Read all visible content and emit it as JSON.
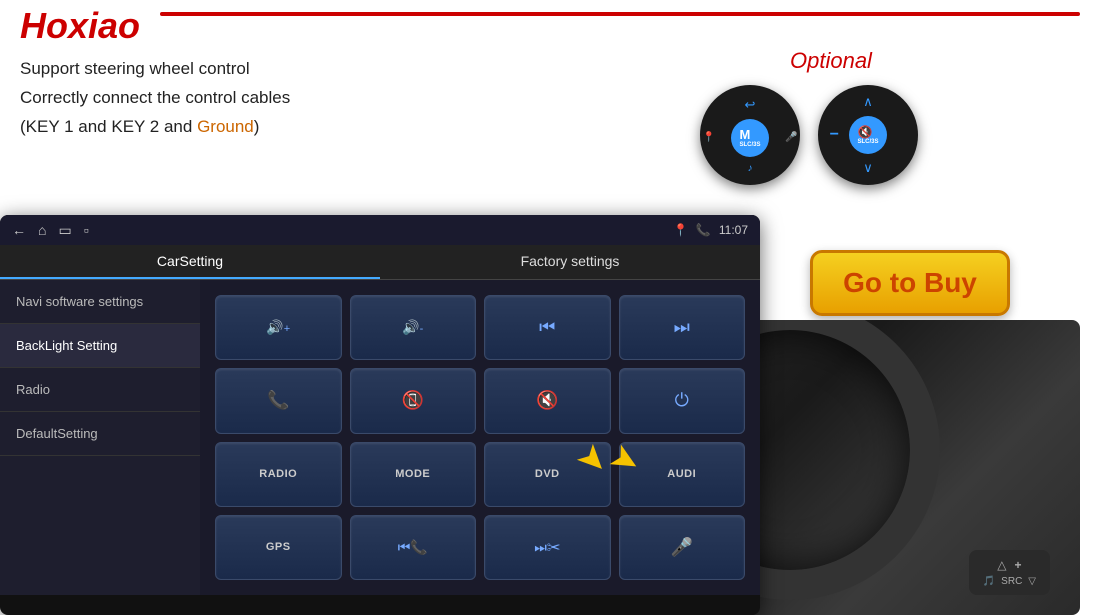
{
  "logo": {
    "text": "Hoxiao"
  },
  "description": {
    "line1": "Support steering wheel control",
    "line2": "Correctly connect the control cables",
    "line3_pre": "(KEY 1 and KEY 2 and ",
    "line3_highlight": "Ground",
    "line3_post": ")"
  },
  "optional": {
    "label": "Optional"
  },
  "go_to_buy": {
    "label": "Go to Buy"
  },
  "screen": {
    "tabs": [
      {
        "label": "CarSetting",
        "active": true
      },
      {
        "label": "Factory settings",
        "active": false
      }
    ],
    "status": {
      "time": "11:07",
      "icons": [
        "📍",
        "📞"
      ]
    },
    "sidebar_items": [
      {
        "label": "Navi software settings",
        "active": false
      },
      {
        "label": "BackLight Setting",
        "active": true
      },
      {
        "label": "Radio",
        "active": false
      },
      {
        "label": "DefaultSetting",
        "active": false
      }
    ],
    "buttons": [
      {
        "type": "icon",
        "icon": "🔊+"
      },
      {
        "type": "icon",
        "icon": "🔊-"
      },
      {
        "type": "icon",
        "icon": "⏮"
      },
      {
        "type": "icon",
        "icon": "⏭"
      },
      {
        "type": "icon",
        "icon": "📞"
      },
      {
        "type": "icon",
        "icon": "📵"
      },
      {
        "type": "icon",
        "icon": "🔇"
      },
      {
        "type": "icon",
        "icon": "⏻"
      },
      {
        "type": "text",
        "icon": "RADIO"
      },
      {
        "type": "text",
        "icon": "MODE"
      },
      {
        "type": "text",
        "icon": "DVD"
      },
      {
        "type": "text",
        "icon": "AUDI"
      },
      {
        "type": "text",
        "icon": "GPS"
      },
      {
        "type": "icon",
        "icon": "⏮📞"
      },
      {
        "type": "icon",
        "icon": "⏭✂"
      },
      {
        "type": "icon",
        "icon": "🎤"
      }
    ]
  },
  "controls": {
    "btn1": {
      "top_icon": "↩",
      "left_icon": "📍",
      "center": "M",
      "center_sub": "SLC/3S",
      "right_icon": "🎤",
      "bottom_icon": "🎵"
    },
    "btn2": {
      "top_icon": "∧",
      "left_icon": "−",
      "center_icon": "🔇",
      "center_sub": "SLC/3S",
      "right_icon": "",
      "bottom_icon": "∨"
    }
  }
}
